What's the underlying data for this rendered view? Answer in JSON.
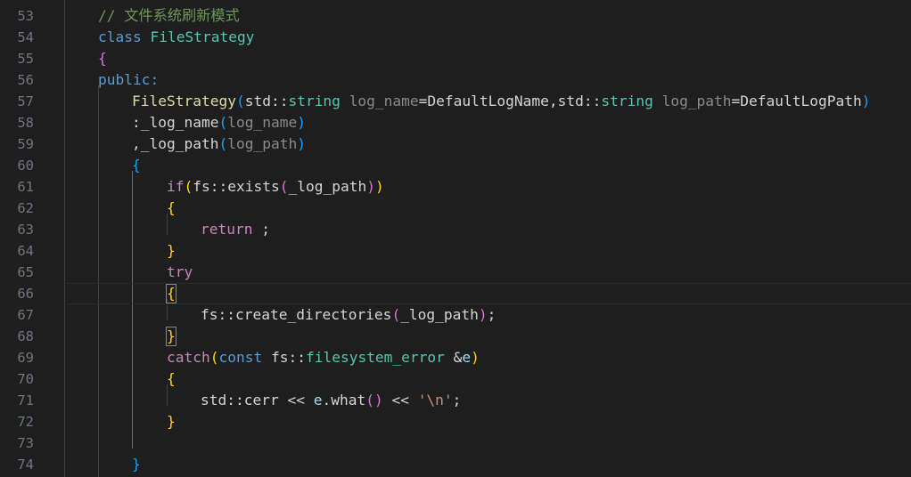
{
  "editor": {
    "line_numbers": [
      "53",
      "54",
      "55",
      "56",
      "57",
      "58",
      "59",
      "60",
      "61",
      "62",
      "63",
      "64",
      "65",
      "66",
      "67",
      "68",
      "69",
      "70",
      "71",
      "72",
      "73",
      "74"
    ],
    "line_53": {
      "comment": "// 文件系统刷新模式"
    },
    "line_54": {
      "kw": "class",
      "name": "FileStrategy"
    },
    "line_55": {
      "brace": "{"
    },
    "line_56": {
      "kw": "public:"
    },
    "line_57": {
      "fn": "FileStrategy",
      "open": "(",
      "ns1": "std",
      "sep1": "::",
      "ty1": "string",
      "sp1": " ",
      "p1": "log_name",
      "eq1": "=DefaultLogName,",
      "ns2": "std",
      "sep2": "::",
      "ty2": "string",
      "sp2": " ",
      "p2": "log_path",
      "eq2": "=DefaultLogPath",
      "close": ")"
    },
    "line_58": {
      "pre": ":",
      "member": "_log_name",
      "open": "(",
      "arg": "log_name",
      "close": ")"
    },
    "line_59": {
      "pre": ",",
      "member": "_log_path",
      "open": "(",
      "arg": "log_path",
      "close": ")"
    },
    "line_60": {
      "brace": "{"
    },
    "line_61": {
      "kw": "if",
      "open": "(",
      "ns": "fs",
      "sep": "::",
      "fn": "exists",
      "open2": "(",
      "arg": "_log_path",
      "close2": ")",
      "close": ")"
    },
    "line_62": {
      "brace": "{"
    },
    "line_63": {
      "kw": "return",
      "rest": " ;"
    },
    "line_64": {
      "brace": "}"
    },
    "line_65": {
      "kw": "try"
    },
    "line_66": {
      "brace": "{"
    },
    "line_67": {
      "ns": "fs",
      "sep": "::",
      "fn": "create_directories",
      "open": "(",
      "arg": "_log_path",
      "close": ")",
      "end": ";"
    },
    "line_68": {
      "brace": "}"
    },
    "line_69": {
      "kw": "catch",
      "open": "(",
      "kw2": "const",
      "sp": " ",
      "ns": "fs",
      "sep": "::",
      "ty": "filesystem_error",
      "amp": " &",
      "var": "e",
      "close": ")"
    },
    "line_70": {
      "brace": "{"
    },
    "line_71": {
      "ns": "std",
      "sep": "::",
      "obj": "cerr",
      "op1": " << ",
      "var": "e",
      "dot": ".",
      "fn": "what",
      "call": "()",
      "op2": " << ",
      "str": "'\\n'",
      "end": ";"
    },
    "line_72": {
      "brace": "}"
    },
    "line_73": {},
    "line_74": {
      "brace": "}"
    }
  },
  "colors": {
    "background": "#1e1e1e",
    "keyword": "#569cd6",
    "control": "#c586c0",
    "function": "#dcdcaa",
    "type": "#4ec9b0",
    "variable": "#9cdcfe",
    "string": "#ce9178",
    "comment": "#6a9955",
    "bracket_level1": "#ffd700",
    "bracket_level2": "#da70d6",
    "bracket_level3": "#179fff"
  }
}
